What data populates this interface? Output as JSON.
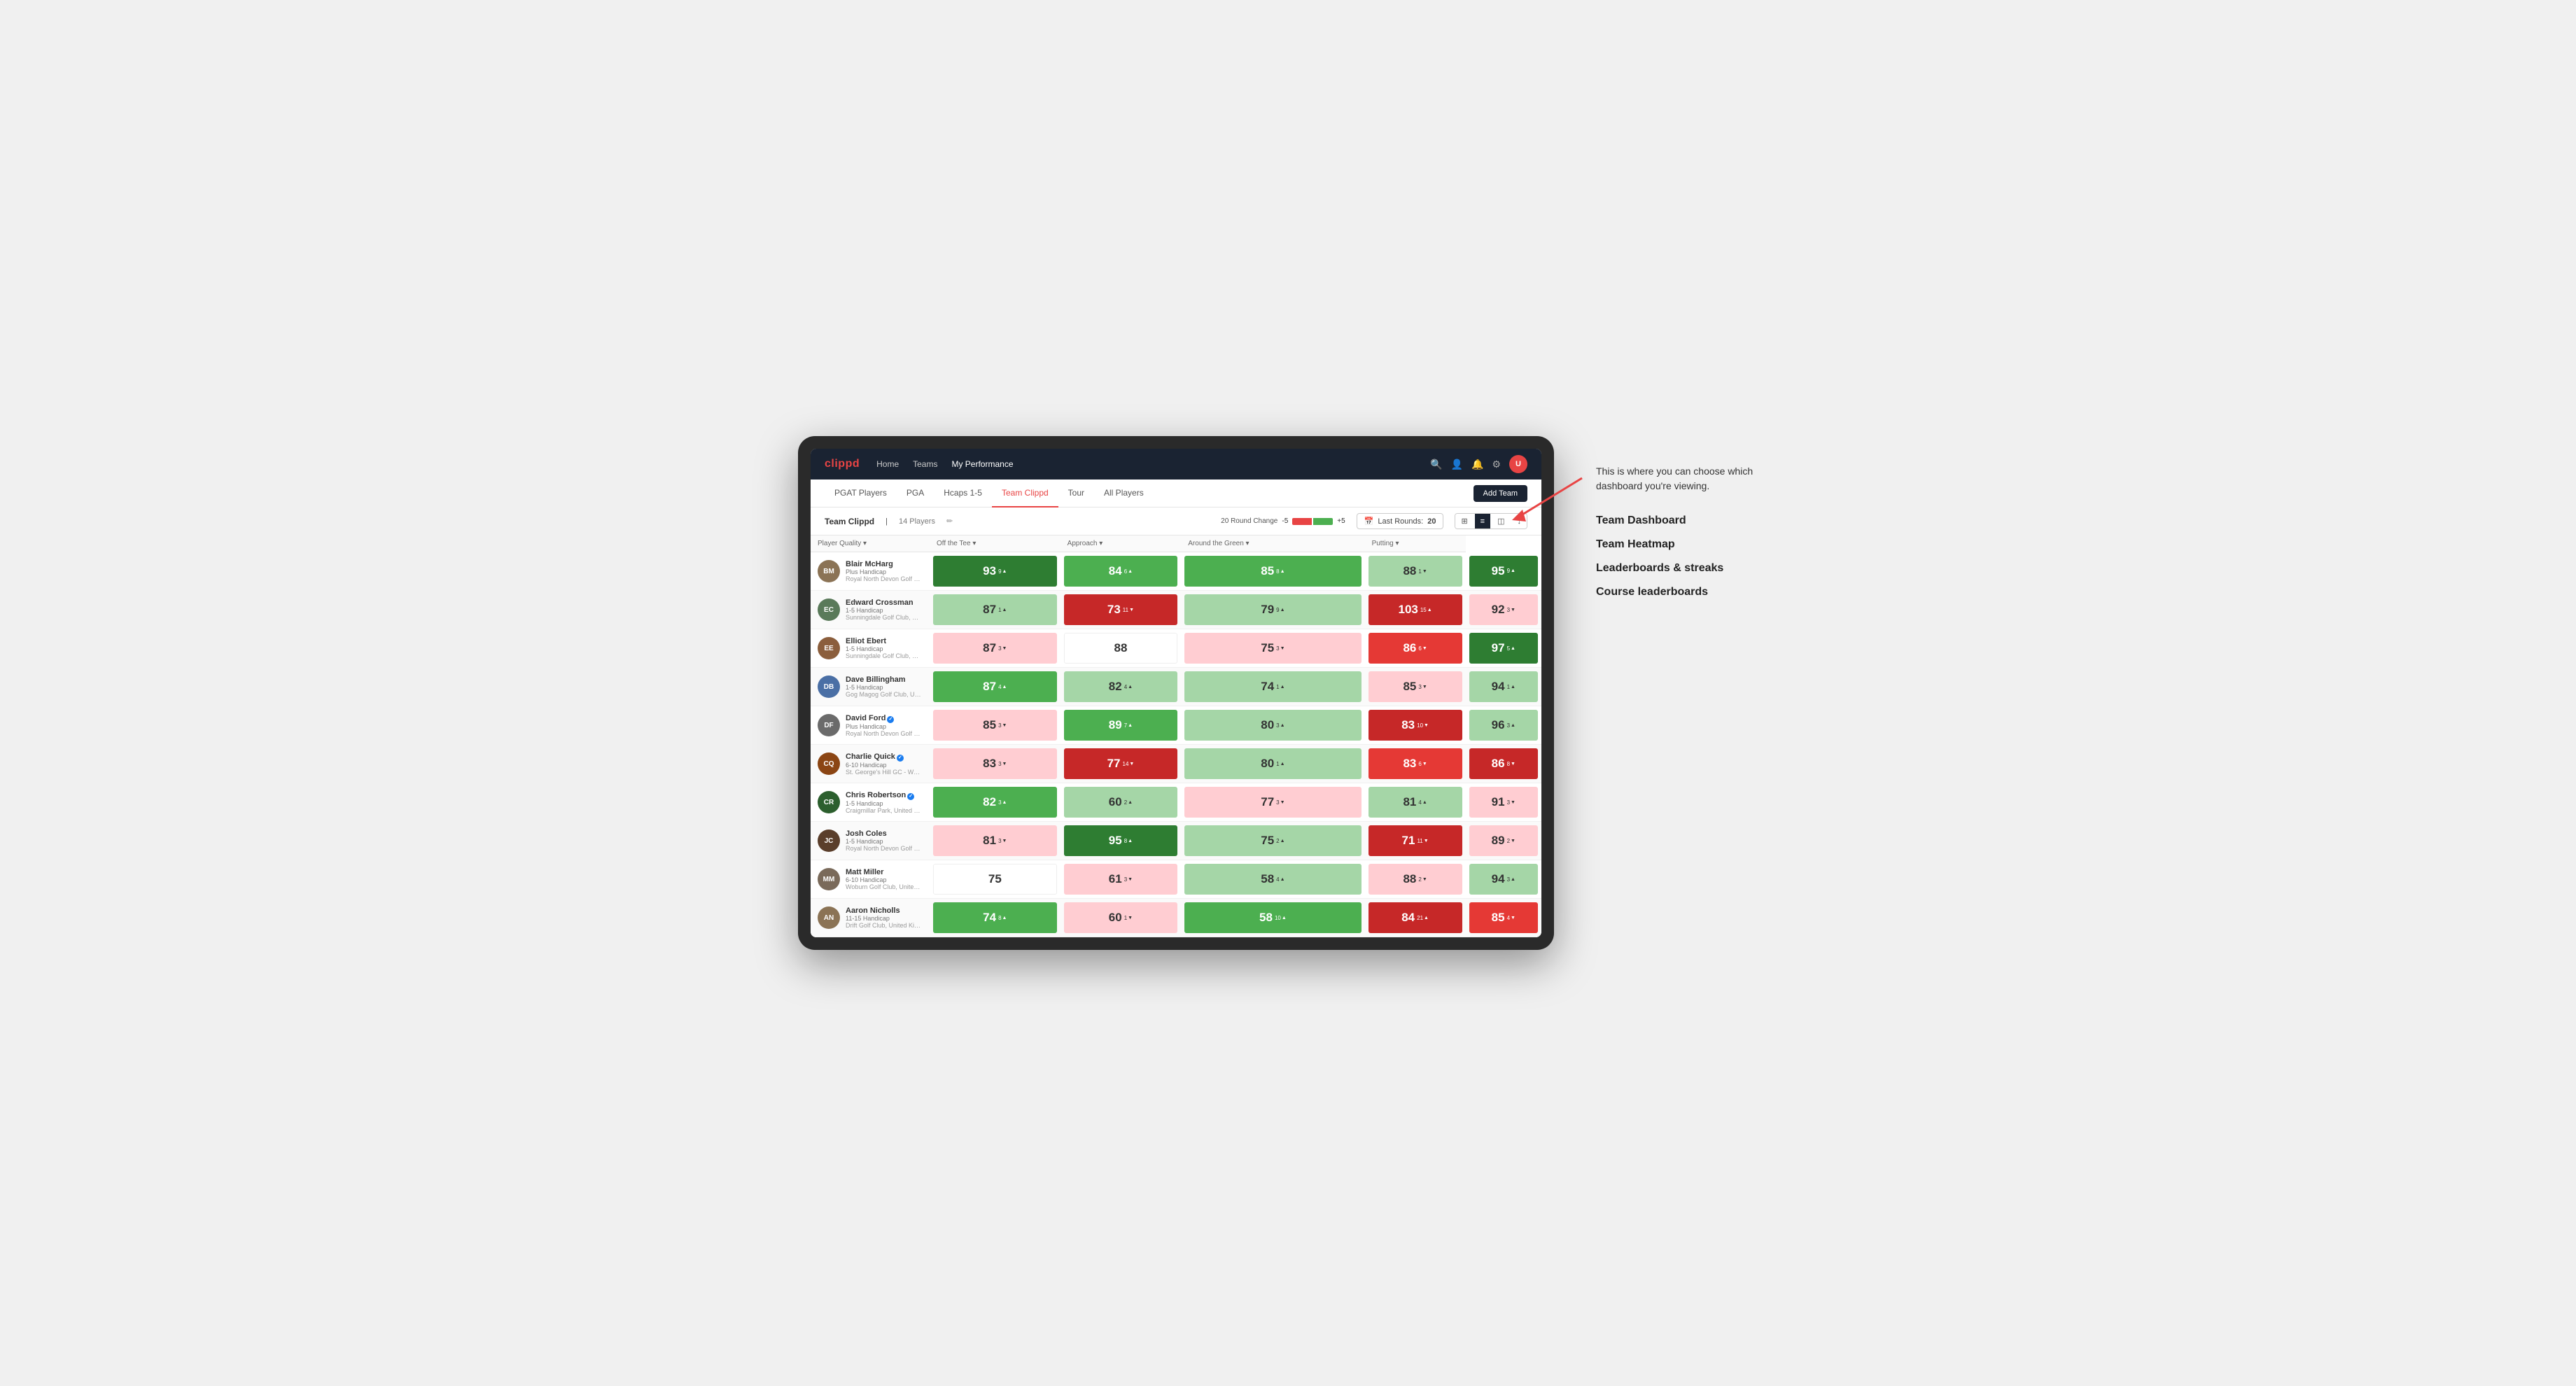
{
  "annotation": {
    "intro": "This is where you can choose which dashboard you're viewing.",
    "items": [
      "Team Dashboard",
      "Team Heatmap",
      "Leaderboards & streaks",
      "Course leaderboards"
    ]
  },
  "nav": {
    "logo": "clippd",
    "links": [
      "Home",
      "Teams",
      "My Performance"
    ],
    "active_link": "My Performance"
  },
  "sub_nav": {
    "links": [
      "PGAT Players",
      "PGA",
      "Hcaps 1-5",
      "Team Clippd",
      "Tour",
      "All Players"
    ],
    "active": "Team Clippd",
    "add_team_label": "Add Team"
  },
  "team_header": {
    "name": "Team Clippd",
    "separator": "|",
    "count": "14 Players",
    "round_change_label": "20 Round Change",
    "neg_val": "-5",
    "pos_val": "+5",
    "last_rounds_label": "Last Rounds:",
    "last_rounds_val": "20"
  },
  "table": {
    "columns": [
      {
        "key": "player",
        "label": "Player Quality ▾"
      },
      {
        "key": "off_tee",
        "label": "Off the Tee ▾"
      },
      {
        "key": "approach",
        "label": "Approach ▾"
      },
      {
        "key": "around_green",
        "label": "Around the Green ▾"
      },
      {
        "key": "putting",
        "label": "Putting ▾"
      }
    ],
    "rows": [
      {
        "name": "Blair McHarg",
        "handicap": "Plus Handicap",
        "club": "Royal North Devon Golf Club, United Kingdom",
        "initials": "BM",
        "color": "#8B7355",
        "player_quality": {
          "val": "93",
          "change": "9",
          "dir": "up",
          "bg": "green-dark"
        },
        "off_tee": {
          "val": "84",
          "change": "6",
          "dir": "up",
          "bg": "green-med"
        },
        "approach": {
          "val": "85",
          "change": "8",
          "dir": "up",
          "bg": "green-med"
        },
        "around_green": {
          "val": "88",
          "change": "1",
          "dir": "down",
          "bg": "green-light"
        },
        "putting": {
          "val": "95",
          "change": "9",
          "dir": "up",
          "bg": "green-dark"
        }
      },
      {
        "name": "Edward Crossman",
        "handicap": "1-5 Handicap",
        "club": "Sunningdale Golf Club, United Kingdom",
        "initials": "EC",
        "color": "#5a7a5a",
        "player_quality": {
          "val": "87",
          "change": "1",
          "dir": "up",
          "bg": "green-light"
        },
        "off_tee": {
          "val": "73",
          "change": "11",
          "dir": "down",
          "bg": "red-dark"
        },
        "approach": {
          "val": "79",
          "change": "9",
          "dir": "up",
          "bg": "green-light"
        },
        "around_green": {
          "val": "103",
          "change": "15",
          "dir": "up",
          "bg": "red-dark"
        },
        "putting": {
          "val": "92",
          "change": "3",
          "dir": "down",
          "bg": "red-light"
        }
      },
      {
        "name": "Elliot Ebert",
        "handicap": "1-5 Handicap",
        "club": "Sunningdale Golf Club, United Kingdom",
        "initials": "EE",
        "color": "#8B5E3C",
        "player_quality": {
          "val": "87",
          "change": "3",
          "dir": "down",
          "bg": "red-light"
        },
        "off_tee": {
          "val": "88",
          "change": "",
          "dir": "",
          "bg": "white"
        },
        "approach": {
          "val": "75",
          "change": "3",
          "dir": "down",
          "bg": "red-light"
        },
        "around_green": {
          "val": "86",
          "change": "6",
          "dir": "down",
          "bg": "red-med"
        },
        "putting": {
          "val": "97",
          "change": "5",
          "dir": "up",
          "bg": "green-dark"
        }
      },
      {
        "name": "Dave Billingham",
        "handicap": "1-5 Handicap",
        "club": "Gog Magog Golf Club, United Kingdom",
        "initials": "DB",
        "color": "#4a6fa5",
        "player_quality": {
          "val": "87",
          "change": "4",
          "dir": "up",
          "bg": "green-med"
        },
        "off_tee": {
          "val": "82",
          "change": "4",
          "dir": "up",
          "bg": "green-light"
        },
        "approach": {
          "val": "74",
          "change": "1",
          "dir": "up",
          "bg": "green-light"
        },
        "around_green": {
          "val": "85",
          "change": "3",
          "dir": "down",
          "bg": "red-light"
        },
        "putting": {
          "val": "94",
          "change": "1",
          "dir": "up",
          "bg": "green-light"
        }
      },
      {
        "name": "David Ford",
        "verified": true,
        "handicap": "Plus Handicap",
        "club": "Royal North Devon Golf Club, United Kingdom",
        "initials": "DF",
        "color": "#6B6B6B",
        "player_quality": {
          "val": "85",
          "change": "3",
          "dir": "down",
          "bg": "red-light"
        },
        "off_tee": {
          "val": "89",
          "change": "7",
          "dir": "up",
          "bg": "green-med"
        },
        "approach": {
          "val": "80",
          "change": "3",
          "dir": "up",
          "bg": "green-light"
        },
        "around_green": {
          "val": "83",
          "change": "10",
          "dir": "down",
          "bg": "red-dark"
        },
        "putting": {
          "val": "96",
          "change": "3",
          "dir": "up",
          "bg": "green-light"
        }
      },
      {
        "name": "Charlie Quick",
        "verified": true,
        "handicap": "6-10 Handicap",
        "club": "St. George's Hill GC - Weybridge - Surrey, Uni...",
        "initials": "CQ",
        "color": "#8B4513",
        "player_quality": {
          "val": "83",
          "change": "3",
          "dir": "down",
          "bg": "red-light"
        },
        "off_tee": {
          "val": "77",
          "change": "14",
          "dir": "down",
          "bg": "red-dark"
        },
        "approach": {
          "val": "80",
          "change": "1",
          "dir": "up",
          "bg": "green-light"
        },
        "around_green": {
          "val": "83",
          "change": "6",
          "dir": "down",
          "bg": "red-med"
        },
        "putting": {
          "val": "86",
          "change": "8",
          "dir": "down",
          "bg": "red-dark"
        }
      },
      {
        "name": "Chris Robertson",
        "verified": true,
        "handicap": "1-5 Handicap",
        "club": "Craigmillar Park, United Kingdom",
        "initials": "CR",
        "color": "#2c5f2e",
        "player_quality": {
          "val": "82",
          "change": "3",
          "dir": "up",
          "bg": "green-med"
        },
        "off_tee": {
          "val": "60",
          "change": "2",
          "dir": "up",
          "bg": "green-light"
        },
        "approach": {
          "val": "77",
          "change": "3",
          "dir": "down",
          "bg": "red-light"
        },
        "around_green": {
          "val": "81",
          "change": "4",
          "dir": "up",
          "bg": "green-light"
        },
        "putting": {
          "val": "91",
          "change": "3",
          "dir": "down",
          "bg": "red-light"
        }
      },
      {
        "name": "Josh Coles",
        "handicap": "1-5 Handicap",
        "club": "Royal North Devon Golf Club, United Kingdom",
        "initials": "JC",
        "color": "#5a3e2b",
        "player_quality": {
          "val": "81",
          "change": "3",
          "dir": "down",
          "bg": "red-light"
        },
        "off_tee": {
          "val": "95",
          "change": "8",
          "dir": "up",
          "bg": "green-dark"
        },
        "approach": {
          "val": "75",
          "change": "2",
          "dir": "up",
          "bg": "green-light"
        },
        "around_green": {
          "val": "71",
          "change": "11",
          "dir": "down",
          "bg": "red-dark"
        },
        "putting": {
          "val": "89",
          "change": "2",
          "dir": "down",
          "bg": "red-light"
        }
      },
      {
        "name": "Matt Miller",
        "handicap": "6-10 Handicap",
        "club": "Woburn Golf Club, United Kingdom",
        "initials": "MM",
        "color": "#7a6a5a",
        "player_quality": {
          "val": "75",
          "change": "",
          "dir": "",
          "bg": "white"
        },
        "off_tee": {
          "val": "61",
          "change": "3",
          "dir": "down",
          "bg": "red-light"
        },
        "approach": {
          "val": "58",
          "change": "4",
          "dir": "up",
          "bg": "green-light"
        },
        "around_green": {
          "val": "88",
          "change": "2",
          "dir": "down",
          "bg": "red-light"
        },
        "putting": {
          "val": "94",
          "change": "3",
          "dir": "up",
          "bg": "green-light"
        }
      },
      {
        "name": "Aaron Nicholls",
        "handicap": "11-15 Handicap",
        "club": "Drift Golf Club, United Kingdom",
        "initials": "AN",
        "color": "#8B7355",
        "player_quality": {
          "val": "74",
          "change": "8",
          "dir": "up",
          "bg": "green-med"
        },
        "off_tee": {
          "val": "60",
          "change": "1",
          "dir": "down",
          "bg": "red-light"
        },
        "approach": {
          "val": "58",
          "change": "10",
          "dir": "up",
          "bg": "green-med"
        },
        "around_green": {
          "val": "84",
          "change": "21",
          "dir": "up",
          "bg": "red-dark"
        },
        "putting": {
          "val": "85",
          "change": "4",
          "dir": "down",
          "bg": "red-med"
        }
      }
    ]
  }
}
